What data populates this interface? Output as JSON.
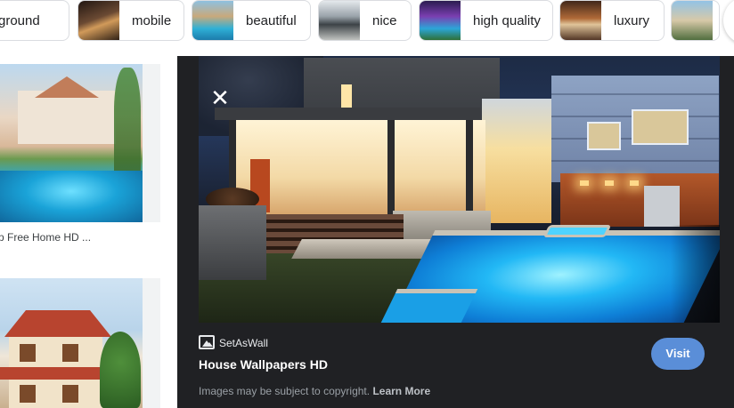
{
  "chips": [
    {
      "label": "background",
      "shown": "ckground",
      "icon": "none"
    },
    {
      "label": "mobile"
    },
    {
      "label": "beautiful"
    },
    {
      "label": "nice"
    },
    {
      "label": "high quality"
    },
    {
      "label": "luxury"
    },
    {
      "label": ""
    }
  ],
  "results": [
    {
      "caption": "p Free Home HD ..."
    }
  ],
  "preview": {
    "source": "SetAsWall",
    "title": "House Wallpapers HD",
    "copyright_text": "Images may be subject to copyright.",
    "learn_more": "Learn More",
    "visit_label": "Visit",
    "close_symbol": "✕"
  },
  "colors": {
    "panel_bg": "#202124",
    "visit_button": "#5a8ed8",
    "chip_border": "#dadce0"
  }
}
